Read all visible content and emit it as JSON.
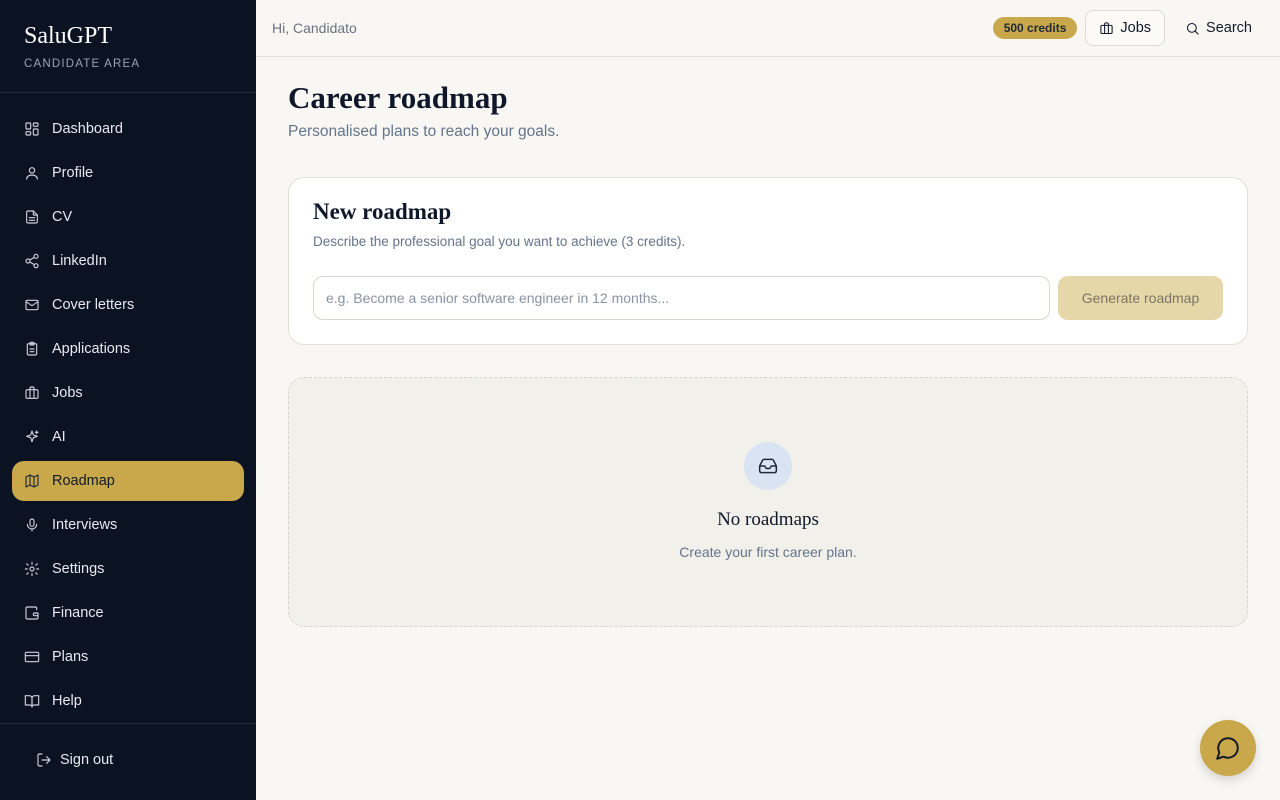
{
  "brand": {
    "title": "SaluGPT",
    "subtitle": "CANDIDATE AREA"
  },
  "sidebar": {
    "items": [
      {
        "label": "Dashboard",
        "icon": "dashboard-icon",
        "active": false
      },
      {
        "label": "Profile",
        "icon": "user-icon",
        "active": false
      },
      {
        "label": "CV",
        "icon": "file-icon",
        "active": false
      },
      {
        "label": "LinkedIn",
        "icon": "share-icon",
        "active": false
      },
      {
        "label": "Cover letters",
        "icon": "mail-icon",
        "active": false
      },
      {
        "label": "Applications",
        "icon": "clipboard-icon",
        "active": false
      },
      {
        "label": "Jobs",
        "icon": "briefcase-icon",
        "active": false
      },
      {
        "label": "AI",
        "icon": "sparkles-icon",
        "active": false
      },
      {
        "label": "Roadmap",
        "icon": "map-icon",
        "active": true
      },
      {
        "label": "Interviews",
        "icon": "microphone-icon",
        "active": false
      },
      {
        "label": "Settings",
        "icon": "gear-icon",
        "active": false
      },
      {
        "label": "Finance",
        "icon": "wallet-icon",
        "active": false
      },
      {
        "label": "Plans",
        "icon": "credit-card-icon",
        "active": false
      },
      {
        "label": "Help",
        "icon": "book-icon",
        "active": false
      }
    ],
    "signout": "Sign out"
  },
  "header": {
    "greeting": "Hi, Candidato",
    "credits": "500 credits",
    "jobs": "Jobs",
    "search": "Search"
  },
  "main": {
    "title": "Career roadmap",
    "subtitle": "Personalised plans to reach your goals.",
    "new_roadmap": {
      "title": "New roadmap",
      "description": "Describe the professional goal you want to achieve (3 credits).",
      "input_value": "",
      "input_placeholder": "e.g. Become a senior software engineer in 12 months...",
      "button": "Generate roadmap"
    },
    "empty": {
      "icon": "inbox-icon",
      "title": "No roadmaps",
      "subtitle": "Create your first career plan."
    }
  },
  "colors": {
    "sidebar_bg": "#0b1222",
    "accent": "#c9a84c",
    "page_bg": "#f8f7f3"
  }
}
